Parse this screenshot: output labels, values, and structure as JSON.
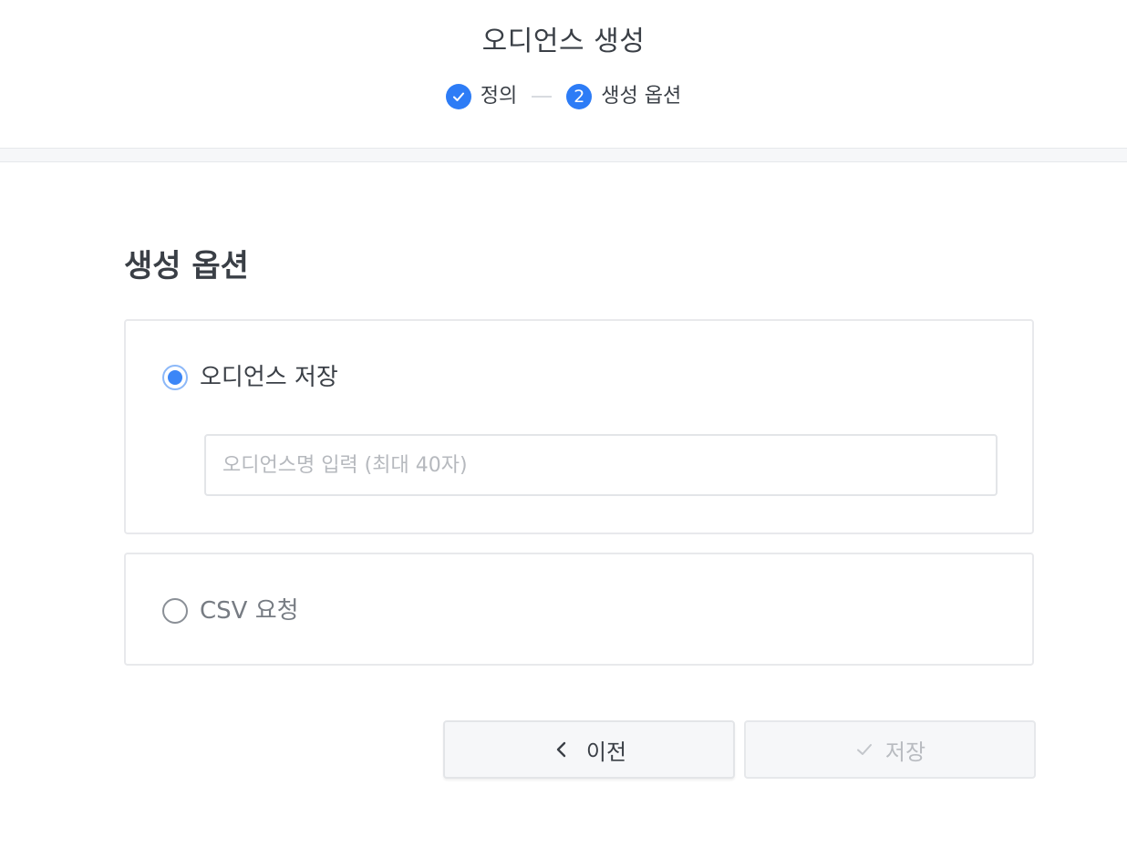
{
  "header": {
    "title": "오디언스 생성",
    "steps": [
      {
        "label": "정의",
        "status": "completed",
        "icon": "check-icon"
      },
      {
        "label": "생성 옵션",
        "status": "current",
        "number": "2"
      }
    ]
  },
  "section": {
    "title": "생성 옵션"
  },
  "options": {
    "save": {
      "label": "오디언스 저장",
      "selected": true,
      "input": {
        "value": "",
        "placeholder": "오디언스명 입력 (최대 40자)"
      }
    },
    "csv": {
      "label": "CSV 요청",
      "selected": false
    }
  },
  "actions": {
    "prev_label": "이전",
    "prev_icon": "chevron-left-icon",
    "save_label": "저장",
    "save_icon": "check-icon",
    "save_disabled": true
  },
  "colors": {
    "accent": "#2d7cf6",
    "radio_selected": "#3b86f7",
    "text_primary": "#3a3f46",
    "text_disabled": "#b8bbc0",
    "border": "#e8e9ec"
  }
}
